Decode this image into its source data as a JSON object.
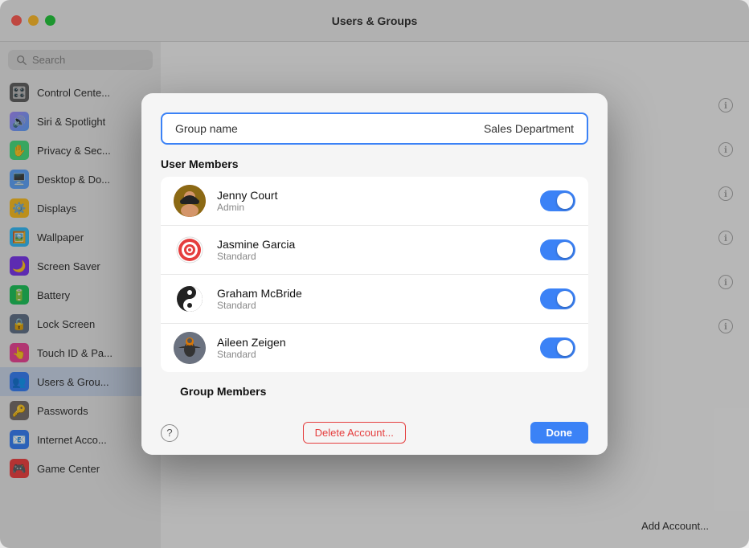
{
  "window": {
    "title": "Users & Groups",
    "controls": {
      "close": "close",
      "minimize": "minimize",
      "maximize": "maximize"
    }
  },
  "sidebar": {
    "search_placeholder": "Search",
    "items": [
      {
        "id": "control-center",
        "label": "Control Cente...",
        "icon": "🎛️",
        "color": "#636363"
      },
      {
        "id": "siri-spotlight",
        "label": "Siri & Spotlight",
        "icon": "🔊",
        "color": "#a78bfa"
      },
      {
        "id": "privacy-security",
        "label": "Privacy & Sec...",
        "icon": "✋",
        "color": "#4ade80"
      },
      {
        "id": "desktop-dock",
        "label": "Desktop & Do...",
        "icon": "🖥️",
        "color": "#60a5fa"
      },
      {
        "id": "displays",
        "label": "Displays",
        "icon": "⚙️",
        "color": "#fbbf24"
      },
      {
        "id": "wallpaper",
        "label": "Wallpaper",
        "icon": "🖼️",
        "color": "#38bdf8"
      },
      {
        "id": "screen-saver",
        "label": "Screen Saver",
        "icon": "🌙",
        "color": "#7c3aed"
      },
      {
        "id": "battery",
        "label": "Battery",
        "icon": "🔋",
        "color": "#22c55e"
      },
      {
        "id": "lock-screen",
        "label": "Lock Screen",
        "icon": "🔒",
        "color": "#64748b"
      },
      {
        "id": "touch-id",
        "label": "Touch ID & Pa...",
        "icon": "👆",
        "color": "#ec4899"
      },
      {
        "id": "users-groups",
        "label": "Users & Grou...",
        "icon": "👥",
        "color": "#3b82f6"
      },
      {
        "id": "passwords",
        "label": "Passwords",
        "icon": "🔑",
        "color": "#78716c"
      },
      {
        "id": "internet-accounts",
        "label": "Internet Acco...",
        "icon": "📧",
        "color": "#3b82f6"
      },
      {
        "id": "game-center",
        "label": "Game Center",
        "icon": "🎮",
        "color": "#ef4444"
      }
    ]
  },
  "info_icons": {
    "count": 6
  },
  "add_account_btn": "Add Account...",
  "modal": {
    "group_name_label": "Group name",
    "group_name_value": "Sales Department",
    "user_members_header": "User Members",
    "users": [
      {
        "name": "Jenny Court",
        "role": "Admin",
        "enabled": true,
        "avatar_emoji": "👩"
      },
      {
        "name": "Jasmine Garcia",
        "role": "Standard",
        "enabled": true,
        "avatar_emoji": "🎯"
      },
      {
        "name": "Graham McBride",
        "role": "Standard",
        "enabled": true,
        "avatar_emoji": "☯️"
      },
      {
        "name": "Aileen Zeigen",
        "role": "Standard",
        "enabled": true,
        "avatar_emoji": "🦅"
      }
    ],
    "group_members_header": "Group Members",
    "footer": {
      "help_label": "?",
      "delete_label": "Delete Account...",
      "done_label": "Done"
    }
  }
}
